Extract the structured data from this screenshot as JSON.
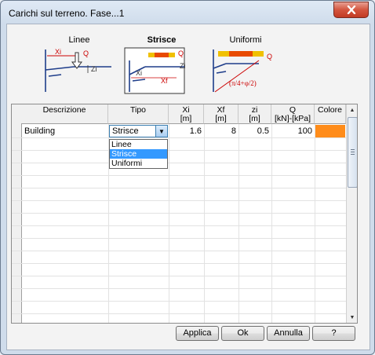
{
  "window": {
    "title": "Carichi sul terreno. Fase...1"
  },
  "diagrams": {
    "linee": {
      "label": "Linee",
      "xi": "Xi",
      "q": "Q",
      "zi": "Zi"
    },
    "strisce": {
      "label": "Strisce",
      "q": "Q",
      "zi": "Zi",
      "xi": "Xi",
      "xf": "Xf"
    },
    "uniformi": {
      "label": "Uniformi",
      "q": "Q",
      "angle": "(π/4+φ/2)"
    }
  },
  "table": {
    "columns": [
      {
        "key": "descrizione",
        "label": "Descrizione"
      },
      {
        "key": "tipo",
        "label": "Tipo"
      },
      {
        "key": "xi",
        "label": "Xi\n[m]"
      },
      {
        "key": "xf",
        "label": "Xf\n[m]"
      },
      {
        "key": "zi",
        "label": "zi\n[m]"
      },
      {
        "key": "q",
        "label": "Q\n[kN]-[kPa]"
      },
      {
        "key": "colore",
        "label": "Colore"
      }
    ],
    "rows": [
      {
        "descrizione": "Building",
        "tipo": "Strisce",
        "xi": "1.6",
        "xf": "8",
        "zi": "0.5",
        "q": "100",
        "colore": "#ff8c1a"
      }
    ],
    "tipo_options": [
      "Linee",
      "Strisce",
      "Uniformi"
    ],
    "tipo_selected": "Strisce"
  },
  "buttons": {
    "applica": "Applica",
    "ok": "Ok",
    "annulla": "Annulla",
    "help": "?"
  },
  "colors": {
    "accent": "#3399ff",
    "close": "#c13a24",
    "load": "#ff8c1a"
  }
}
